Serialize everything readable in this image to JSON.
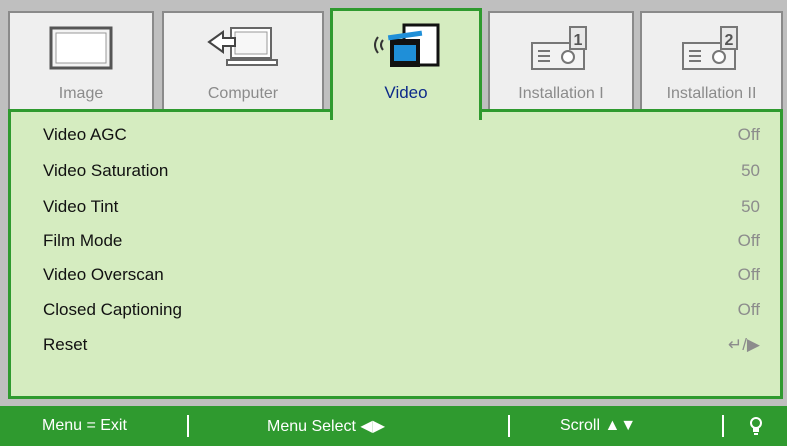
{
  "tabs": [
    {
      "label": "Image",
      "icon": "monitor-icon",
      "active": false
    },
    {
      "label": "Computer",
      "icon": "computer-icon",
      "active": false
    },
    {
      "label": "Video",
      "icon": "video-broadcast-icon",
      "active": true
    },
    {
      "label": "Installation I",
      "icon": "projector-1-icon",
      "active": false
    },
    {
      "label": "Installation II",
      "icon": "projector-2-icon",
      "active": false
    }
  ],
  "settings": [
    {
      "name": "Video AGC",
      "value": "Off"
    },
    {
      "name": "Video Saturation",
      "value": "50"
    },
    {
      "name": "Video Tint",
      "value": "50"
    },
    {
      "name": "Film Mode",
      "value": "Off"
    },
    {
      "name": "Video Overscan",
      "value": "Off"
    },
    {
      "name": "Closed Captioning",
      "value": "Off"
    },
    {
      "name": "Reset",
      "value": "↵/▶"
    }
  ],
  "helpbar": {
    "exit": "Menu = Exit",
    "select": "Menu Select ◀▶",
    "scroll": "Scroll ▲▼",
    "lamp_icon": "lamp-icon"
  },
  "colors": {
    "accent_green": "#2f9a2f",
    "panel_bg": "#d5ecc0",
    "frame_gray": "#bfbfbf",
    "active_label": "#0c2a8a"
  }
}
